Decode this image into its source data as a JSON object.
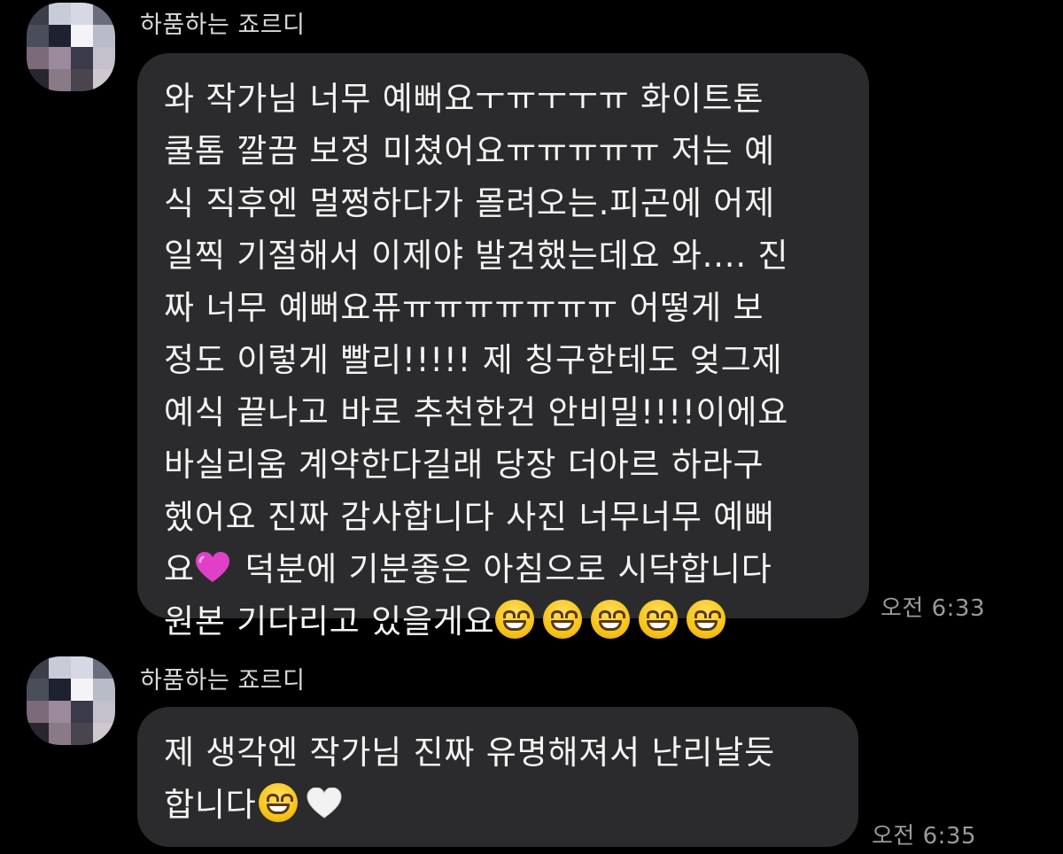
{
  "colors": {
    "background": "#000000",
    "bubble": "#2b2b2d",
    "sender_name": "#d8d8d8",
    "timestamp": "#9a9a9a",
    "pink_heart": "#e040c8",
    "white_heart": "#f2f2f2"
  },
  "messages": [
    {
      "sender": "하품하는 죠르디",
      "avatar_icon": "pixelated-avatar",
      "lines": [
        "와 작가님 너무 예뻐요ㅜㅠㅜㅜㅠ 화이트톤",
        "쿨톰 깔끔 보정 미쳤어요ㅠㅠㅠㅠㅠ 저는 예",
        "식 직후엔 멀쩡하다가 몰려오는.피곤에 어제",
        "일찍 기절해서 이제야 발견했는데요 와.... 진",
        "짜 너무 예뻐요퓨ㅠㅠㅠㅠㅠㅠㅠ 어떻게 보",
        "정도 이렇게 빨리!!!!! 제 칭구한테도 엊그제",
        "예식 끝나고 바로 추천한건 안비밀!!!!이에요",
        "바실리움 계약한다길래 당장 더아르 하라구",
        "헸어요 진짜 감사합니다  사진 너무너무 예뻐",
        "덕분에 기분좋은 아침으로 시닥합니다",
        "원본 기다리고 있을게요"
      ],
      "line10_prefix": "요",
      "emojis_inline": [
        "pink-heart-icon",
        "grinning-face-icon x5"
      ],
      "timestamp": "오전 6:33"
    },
    {
      "sender": "하품하는 죠르디",
      "avatar_icon": "pixelated-avatar",
      "lines": [
        "제 생각엔 작가님 진짜 유명해져서 난리날듯",
        "합니다"
      ],
      "emojis_inline": [
        "grinning-face-icon",
        "white-heart-icon"
      ],
      "timestamp": "오전 6:35"
    }
  ]
}
